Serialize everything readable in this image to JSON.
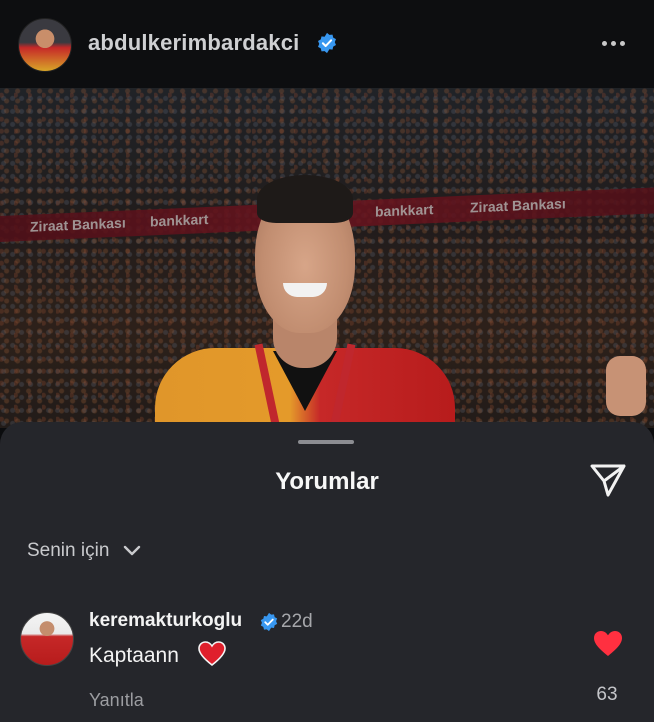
{
  "post": {
    "username": "abdulkerimbardakci",
    "verified_icon": "verified-badge-icon",
    "more_icon": "more-options-icon"
  },
  "photo": {
    "banner_texts": [
      "Ziraat Bankası",
      "bankkart",
      "Ziraat Bankası",
      "bankkart",
      "Ziraat Bankası"
    ]
  },
  "comments_sheet": {
    "title": "Yorumlar",
    "share_icon": "send-icon",
    "filter_label": "Senin için",
    "comments": [
      {
        "username": "keremakturkoglu",
        "verified": true,
        "time": "22d",
        "text": "Kaptaann",
        "reply_label": "Yanıtla",
        "like_count": "63"
      }
    ]
  },
  "colors": {
    "verified_blue": "#3897f0",
    "heart_red": "#ff3040",
    "sheet_bg": "#25262b"
  }
}
